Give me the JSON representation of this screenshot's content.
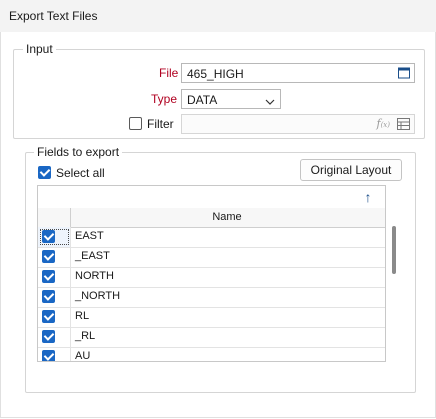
{
  "window": {
    "title": "Export Text Files"
  },
  "input_group": {
    "title": "Input",
    "file_label": "File",
    "file_value": "465_HIGH",
    "type_label": "Type",
    "type_value": "DATA",
    "filter_label": "Filter",
    "filter_checked": false,
    "filter_value": ""
  },
  "fields_group": {
    "title": "Fields to export",
    "select_all_label": "Select all",
    "select_all_checked": true,
    "original_layout_label": "Original Layout",
    "move_up_glyph": "↑",
    "move_down_glyph": "↓",
    "column_header": "Name",
    "rows": [
      {
        "name": "EAST",
        "checked": true
      },
      {
        "name": "_EAST",
        "checked": true
      },
      {
        "name": "NORTH",
        "checked": true
      },
      {
        "name": "_NORTH",
        "checked": true
      },
      {
        "name": "RL",
        "checked": true
      },
      {
        "name": "_RL",
        "checked": true
      },
      {
        "name": "AU",
        "checked": true
      }
    ]
  },
  "colors": {
    "accent": "#1a67c4",
    "required_label": "#b00020"
  },
  "icons": [
    "file-browse-icon",
    "chevron-down-icon",
    "function-icon",
    "filter-list-icon",
    "arrow-up-icon",
    "arrow-down-icon"
  ]
}
